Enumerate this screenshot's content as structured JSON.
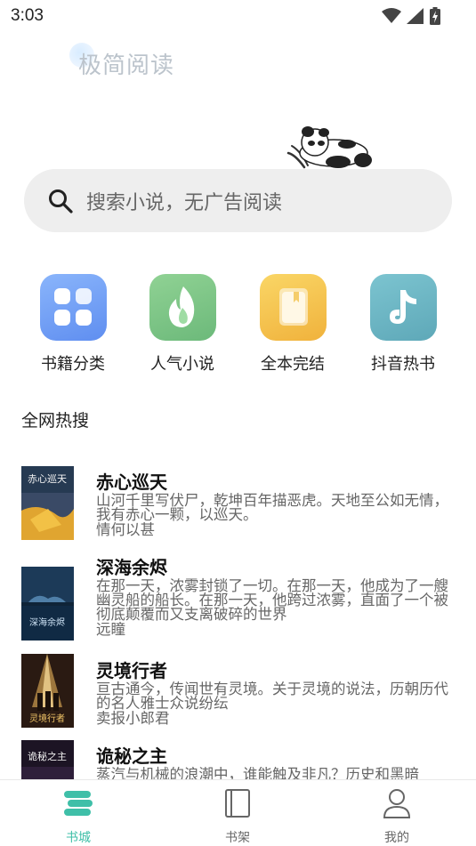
{
  "status_bar": {
    "time": "3:03"
  },
  "app": {
    "logo_text": "极简阅读"
  },
  "search": {
    "placeholder": "搜索小说，无广告阅读"
  },
  "categories": [
    {
      "label": "书籍分类",
      "icon": "grid-icon",
      "color": "#6e9ef5"
    },
    {
      "label": "人气小说",
      "icon": "flame-icon",
      "color": "#7dc486"
    },
    {
      "label": "全本完结",
      "icon": "book-icon",
      "color": "#f2be45"
    },
    {
      "label": "抖音热书",
      "icon": "tiktok-icon",
      "color": "#6cb5c4"
    }
  ],
  "hot_section": {
    "title": "全网热搜"
  },
  "books": [
    {
      "title": "赤心巡天",
      "description": "山河千里写伏尸，乾坤百年描恶虎。天地至公如无情，我有赤心一颗，以巡天。",
      "author": "情何以甚",
      "cover_text": "赤心巡天"
    },
    {
      "title": "深海余烬",
      "description": "在那一天，浓雾封锁了一切。在那一天，他成为了一艘幽灵船的船长。在那一天，他跨过浓雾，直面了一个被彻底颠覆而又支离破碎的世界",
      "author": "远瞳",
      "cover_text": "深海余烬"
    },
    {
      "title": "灵境行者",
      "description": "亘古通今，传闻世有灵境。关于灵境的说法，历朝历代的名人雅士众说纷纭",
      "author": "卖报小郎君",
      "cover_text": "灵境行者"
    },
    {
      "title": "诡秘之主",
      "description": "蒸汽与机械的浪潮中，谁能触及非凡？历史和黑暗",
      "author": "",
      "cover_text": "诡秘之主"
    }
  ],
  "tabbar": {
    "accent_color": "#3fbfa8",
    "items": [
      {
        "label": "书城",
        "icon": "bookstore-icon",
        "active": true
      },
      {
        "label": "书架",
        "icon": "bookshelf-icon",
        "active": false
      },
      {
        "label": "我的",
        "icon": "profile-icon",
        "active": false
      }
    ]
  }
}
